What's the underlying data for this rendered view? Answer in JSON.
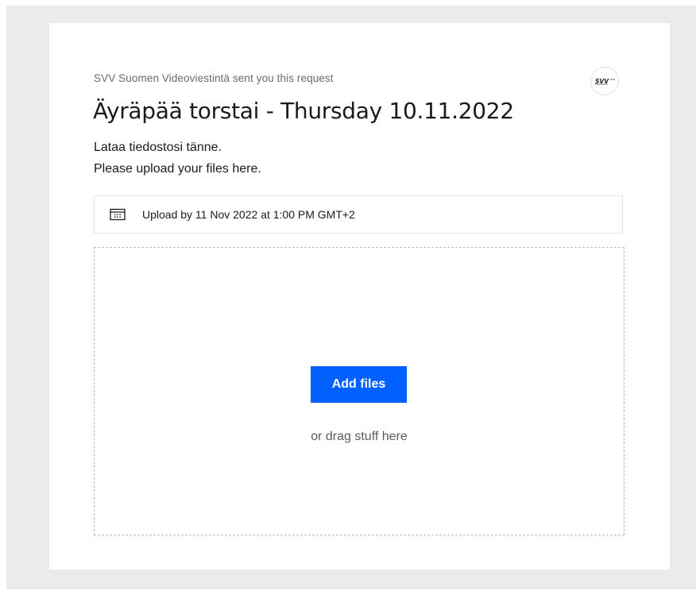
{
  "request": {
    "sender_line": "SVV Suomen Videoviestintä sent you this request",
    "logo_text": "SVV",
    "title": "Äyräpää torstai - Thursday 10.11.2022",
    "description_line1": "Lataa tiedostosi tänne.",
    "description_line2": "Please upload your files here."
  },
  "deadline": {
    "icon": "calendar-icon",
    "text": "Upload by 11 Nov 2022 at 1:00 PM GMT+2"
  },
  "dropzone": {
    "button_label": "Add files",
    "hint": "or drag stuff here"
  },
  "colors": {
    "accent": "#0061fe",
    "background": "#ecebea",
    "text": "#1e1919"
  }
}
